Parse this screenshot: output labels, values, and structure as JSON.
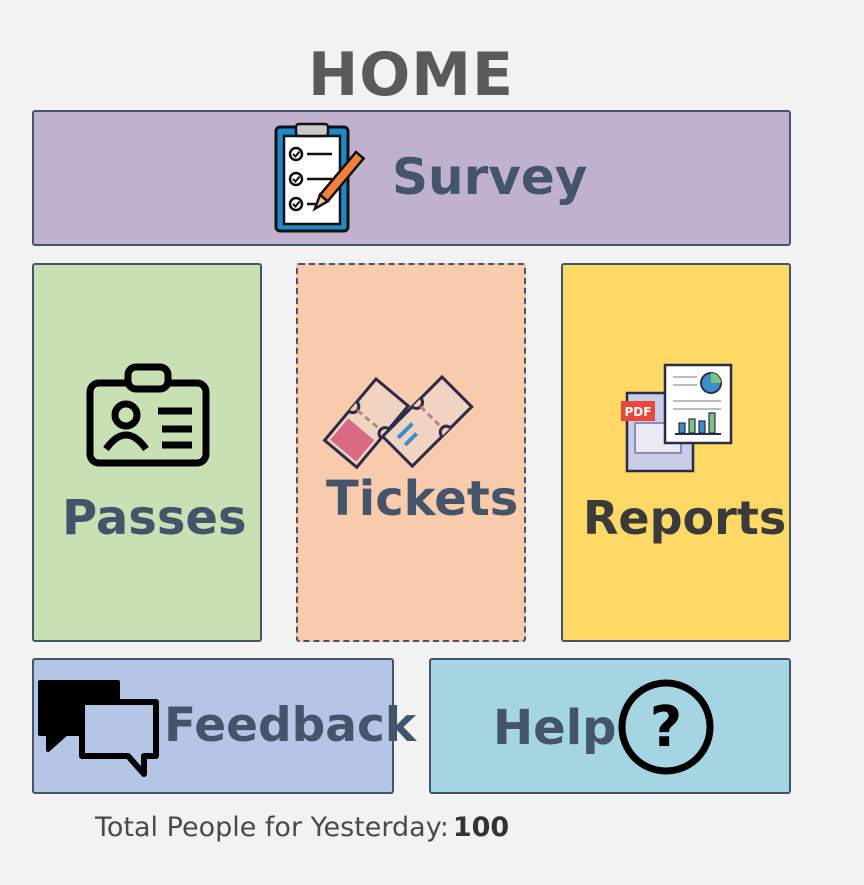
{
  "page": {
    "title": "HOME"
  },
  "tiles": {
    "survey": {
      "label": "Survey",
      "icon": "clipboard-checklist-icon",
      "color": "#c0b2cf"
    },
    "passes": {
      "label": "Passes",
      "icon": "id-badge-icon",
      "color": "#c8e0b4"
    },
    "tickets": {
      "label": "Tickets",
      "icon": "tickets-icon",
      "color": "#f8cbad"
    },
    "reports": {
      "label": "Reports",
      "icon": "pdf-report-icon",
      "pdf_text": "PDF",
      "color": "#fed965"
    },
    "feedback": {
      "label": "Feedback",
      "icon": "speech-bubbles-icon",
      "color": "#b4c5e6"
    },
    "help": {
      "label": "Help",
      "icon": "question-circle-icon",
      "color": "#a5d4e2"
    }
  },
  "footer": {
    "label": "Total People for Yesterday:",
    "value": "100"
  }
}
